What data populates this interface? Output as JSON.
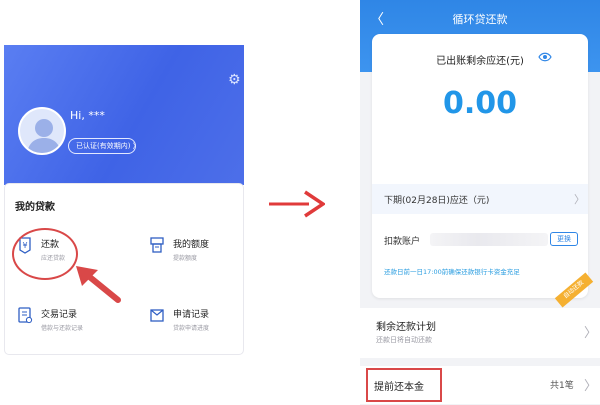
{
  "colors": {
    "brand_blue": "#2f86e6",
    "amount_blue": "#2196e8",
    "left_header": "#4a6ee9",
    "annotation_red": "#d94848",
    "badge_orange": "#f5b031"
  },
  "left": {
    "greeting": "Hi, ***",
    "verified_pill": "已认证(有效期内) 〉",
    "loans": {
      "title": "我的贷款",
      "tiles": [
        {
          "title": "还款",
          "sub": "应还贷款",
          "icon": "repay-icon"
        },
        {
          "title": "我的额度",
          "sub": "提款额度",
          "icon": "quota-icon"
        },
        {
          "title": "交易记录",
          "sub": "借款与还款记录",
          "icon": "records-icon"
        },
        {
          "title": "申请记录",
          "sub": "贷款申请进度",
          "icon": "application-icon"
        }
      ]
    }
  },
  "right": {
    "nav": {
      "title": "循环贷还款",
      "back": "〈"
    },
    "summary": {
      "label": "已出账剩余应还(元)",
      "amount": "0.00",
      "next_label": "下期(02月28日)应还（元)",
      "account_label": "扣款账户",
      "change_button": "更换",
      "note": "还款日前一日17:00前确保还款银行卡资金充足",
      "auto_badge": "自动还款"
    },
    "plan": {
      "title": "剩余还款计划",
      "sub": "还款日将自动还款"
    },
    "prepay": {
      "label": "提前还本金",
      "count": "共1笔"
    }
  }
}
